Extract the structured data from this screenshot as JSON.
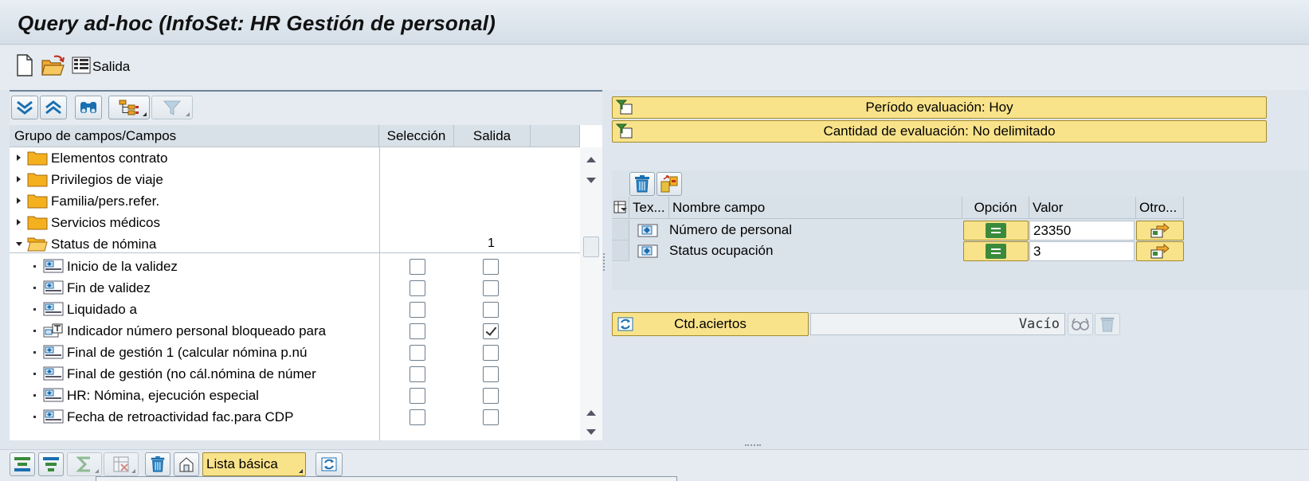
{
  "window": {
    "title": "Query ad-hoc (InfoSet: HR Gestión de personal)"
  },
  "toolbar": {
    "new_icon": "new-document-icon",
    "open_icon": "open-folder-icon",
    "output_icon": "output-list-icon",
    "output_label": "Salida"
  },
  "field_tree": {
    "toolbar_icons": [
      "expand-all-icon",
      "collapse-all-icon",
      "find-icon",
      "field-layout-icon",
      "filter-icon"
    ],
    "headers": {
      "field": "Grupo de campos/Campos",
      "selection": "Selección",
      "output": "Salida"
    },
    "groups": [
      {
        "label": "Elementos contrato",
        "expanded": false
      },
      {
        "label": "Privilegios de viaje",
        "expanded": false
      },
      {
        "label": "Familia/pers.refer.",
        "expanded": false
      },
      {
        "label": "Servicios médicos",
        "expanded": false
      },
      {
        "label": "Status de nómina",
        "expanded": true,
        "output_count": "1"
      }
    ],
    "fields": [
      {
        "label": "Inicio de la validez",
        "selection": false,
        "output": false,
        "icon": "field-icon"
      },
      {
        "label": "Fin de validez",
        "selection": false,
        "output": false,
        "icon": "field-icon"
      },
      {
        "label": "Liquidado a",
        "selection": false,
        "output": false,
        "icon": "field-icon"
      },
      {
        "label": "Indicador número personal bloqueado para",
        "selection": false,
        "output": true,
        "icon": "text-field-icon"
      },
      {
        "label": "Final de gestión 1 (calcular nómina p.nú",
        "selection": false,
        "output": false,
        "icon": "field-icon"
      },
      {
        "label": "Final de gestión (no cál.nómina de númer",
        "selection": false,
        "output": false,
        "icon": "field-icon"
      },
      {
        "label": "HR: Nómina, ejecución especial",
        "selection": false,
        "output": false,
        "icon": "field-icon"
      },
      {
        "label": "Fecha de retroactividad fac.para CDP",
        "selection": false,
        "output": false,
        "icon": "field-icon"
      }
    ]
  },
  "evaluation": {
    "period_label": "Período evaluación: Hoy",
    "quantity_label": "Cantidad de evaluación: No delimitado"
  },
  "selection_grid": {
    "headers": {
      "text": "Tex...",
      "field_name": "Nombre campo",
      "option": "Opción",
      "value": "Valor",
      "other": "Otro..."
    },
    "rows": [
      {
        "field_name": "Número de personal",
        "option": "=",
        "value": "23350"
      },
      {
        "field_name": "Status ocupación",
        "option": "=",
        "value": "3"
      }
    ]
  },
  "hits": {
    "button_label": "Ctd.aciertos",
    "result": "Vacío"
  },
  "bottom_toolbar": {
    "layout_dropdown": "Lista básica"
  },
  "colors": {
    "button_yellow": "#f9e38a",
    "panel_bg": "#dfe6ed",
    "header_bg": "#d9e1e8",
    "option_green": "#3b8a3b"
  }
}
